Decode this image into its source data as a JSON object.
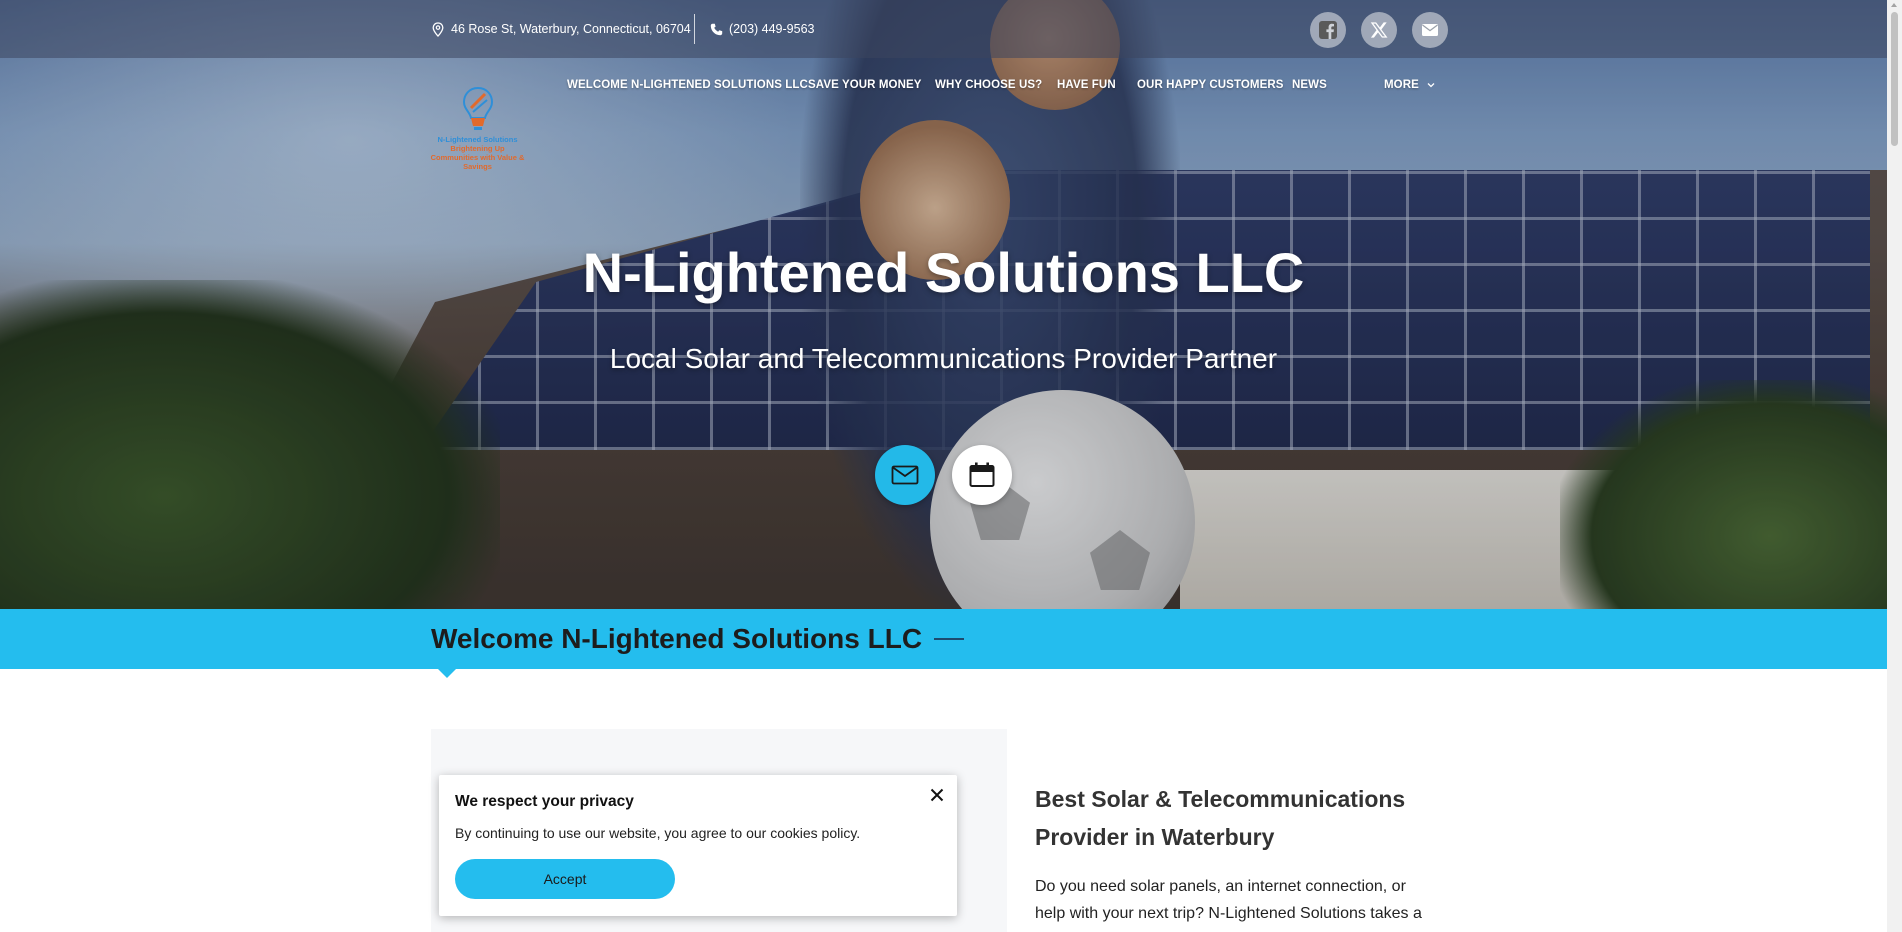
{
  "topbar": {
    "address": "46 Rose St, Waterbury, Connecticut, 06704",
    "phone": "(203) 449-9563",
    "social": [
      "facebook-icon",
      "x-icon",
      "mail-icon"
    ]
  },
  "logo": {
    "brand": "N-Lightened Solutions",
    "tagline": "Brightening Up Communities with Value & Savings"
  },
  "nav": {
    "items": [
      "WELCOME N-LIGHTENED SOLUTIONS LLC",
      "SAVE YOUR MONEY",
      "WHY CHOOSE US?",
      "HAVE FUN",
      "OUR HAPPY CUSTOMERS",
      "NEWS"
    ],
    "more": "MORE"
  },
  "hero": {
    "title": "N-Lightened Solutions LLC",
    "subtitle": "Local Solar and Telecommunications Provider Partner",
    "buttons": [
      "mail-icon",
      "calendar-icon"
    ]
  },
  "section": {
    "title": "Welcome N-Lightened Solutions LLC"
  },
  "content": {
    "heading": "Best Solar & Telecommunications Provider in Waterbury",
    "text": "Do you need solar panels, an internet connection, or help with your next trip? N-Lightened Solutions takes a"
  },
  "cookie": {
    "title": "We respect your privacy",
    "body": "By continuing to use our website, you agree to our cookies policy.",
    "accept": "Accept"
  },
  "colors": {
    "accent": "#24bdee",
    "topbar": "#3c465f"
  }
}
